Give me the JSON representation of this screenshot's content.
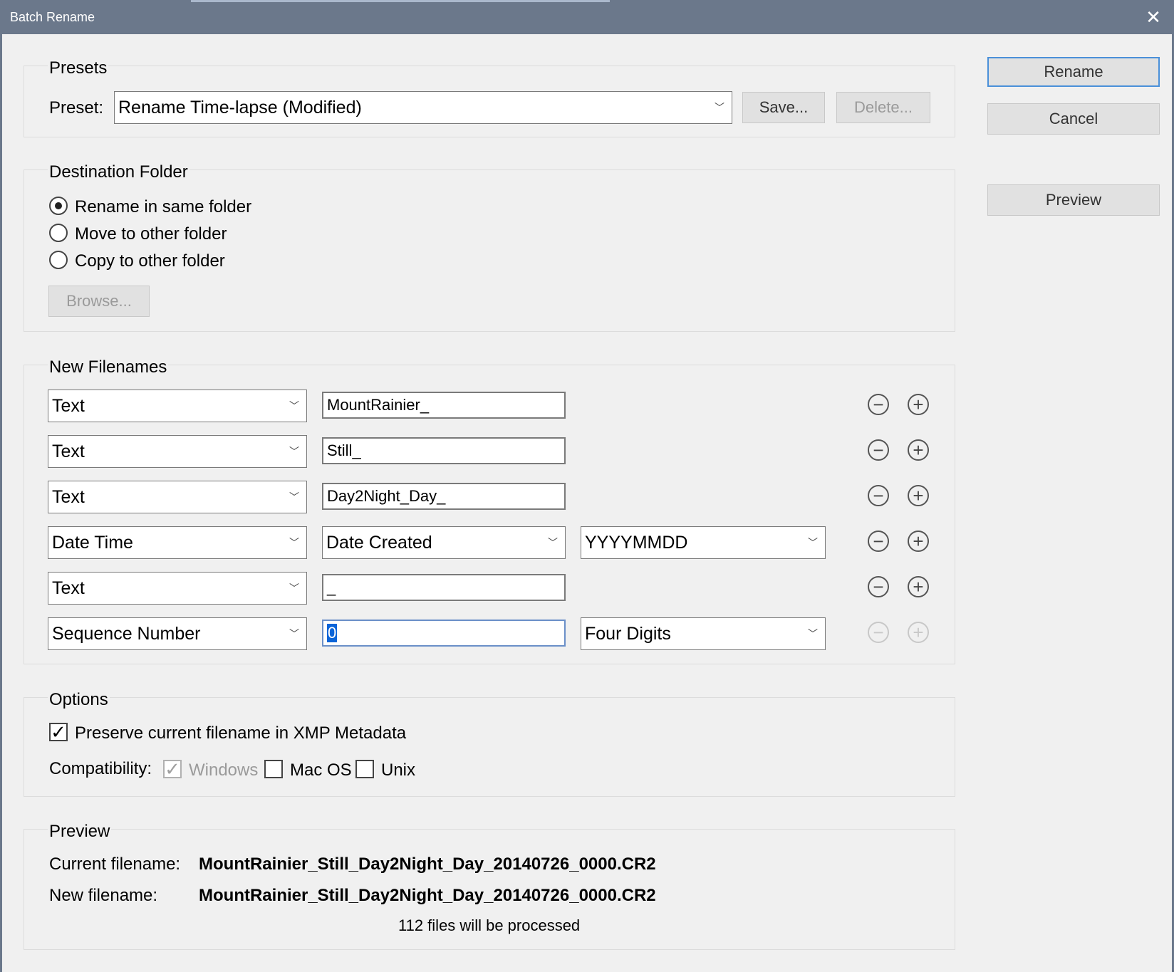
{
  "window": {
    "title": "Batch Rename"
  },
  "actions": {
    "rename": "Rename",
    "cancel": "Cancel",
    "preview": "Preview"
  },
  "presets": {
    "legend": "Presets",
    "preset_label": "Preset:",
    "preset_value": "Rename Time-lapse (Modified)",
    "save": "Save...",
    "delete": "Delete..."
  },
  "destination": {
    "legend": "Destination Folder",
    "options": [
      "Rename in same folder",
      "Move to other folder",
      "Copy to other folder"
    ],
    "selected": "Rename in same folder",
    "browse": "Browse..."
  },
  "filenames": {
    "legend": "New Filenames",
    "rows": [
      {
        "type": "Text",
        "value": "MountRainier_"
      },
      {
        "type": "Text",
        "value": "Still_"
      },
      {
        "type": "Text",
        "value": "Day2Night_Day_"
      },
      {
        "type": "Date Time",
        "value": "Date Created",
        "format": "YYYYMMDD"
      },
      {
        "type": "Text",
        "value": "_"
      },
      {
        "type": "Sequence Number",
        "value": "0",
        "format": "Four Digits"
      }
    ]
  },
  "options": {
    "legend": "Options",
    "preserve_label": "Preserve current filename in XMP Metadata",
    "preserve_checked": true,
    "compat_label": "Compatibility:",
    "windows": "Windows",
    "windows_checked": true,
    "macos": "Mac OS",
    "macos_checked": false,
    "unix": "Unix",
    "unix_checked": false
  },
  "preview": {
    "legend": "Preview",
    "current_label": "Current filename:",
    "current_value": "MountRainier_Still_Day2Night_Day_20140726_0000.CR2",
    "new_label": "New filename:",
    "new_value": "MountRainier_Still_Day2Night_Day_20140726_0000.CR2",
    "count_text": "112 files will be processed"
  }
}
